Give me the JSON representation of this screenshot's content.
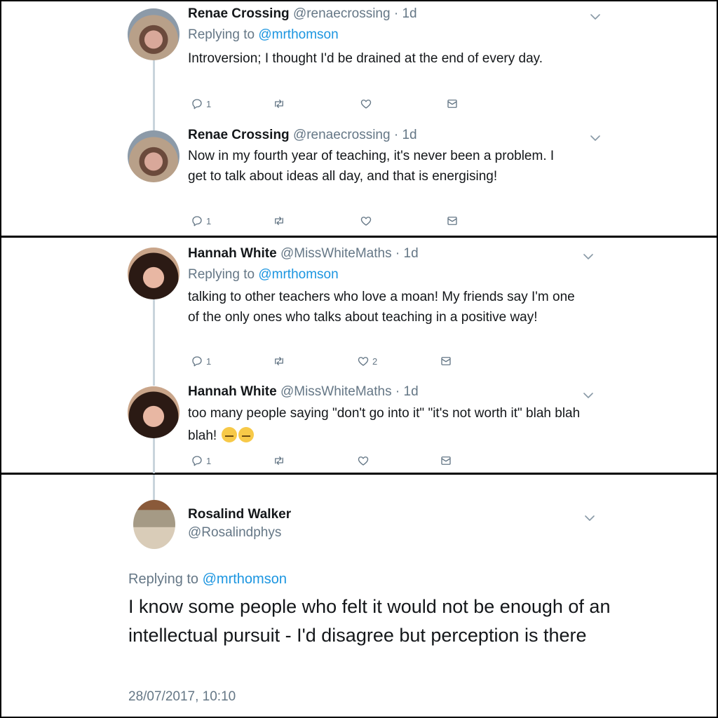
{
  "tweets": [
    {
      "name": "Renae Crossing",
      "handle": "@renaecrossing",
      "time": "· 1d",
      "replying_prefix": "Replying to ",
      "replying_to": "@mrthomson",
      "text": "Introversion; I thought I'd be drained at the end of every day.",
      "reply_count": "1",
      "like_count": ""
    },
    {
      "name": "Renae Crossing",
      "handle": "@renaecrossing",
      "time": "· 1d",
      "text": "Now in my fourth year of teaching, it's never been a problem. I get to talk about ideas all day, and that is energising!",
      "reply_count": "1",
      "like_count": ""
    },
    {
      "name": "Hannah White",
      "handle": "@MissWhiteMaths",
      "time": "· 1d",
      "replying_prefix": "Replying to ",
      "replying_to": "@mrthomson",
      "text": "talking to other teachers who love a moan! My friends say I'm one of the only ones who talks about teaching in a positive way!",
      "reply_count": "1",
      "like_count": "2"
    },
    {
      "name": "Hannah White",
      "handle": "@MissWhiteMaths",
      "time": "· 1d",
      "text": "too many people saying \"don't go into it\" \"it's not worth it\" blah blah blah!",
      "reply_count": "1",
      "like_count": ""
    }
  ],
  "main_tweet": {
    "name": "Rosalind Walker",
    "handle": "@Rosalindphys",
    "replying_prefix": "Replying to ",
    "replying_to": "@mrthomson",
    "text": "I know some people who felt it would not be enough of an intellectual pursuit - I'd disagree but perception is there",
    "timestamp": "28/07/2017, 10:10"
  },
  "icons": {
    "reply": "reply-icon",
    "retweet": "retweet-icon",
    "like": "heart-icon",
    "dm": "envelope-icon",
    "menu": "chevron-down-icon",
    "emoji": "sleepy-face-emoji"
  },
  "colors": {
    "link": "#1b95e0",
    "muted": "#657786",
    "thread_line": "#c9d4dc"
  }
}
